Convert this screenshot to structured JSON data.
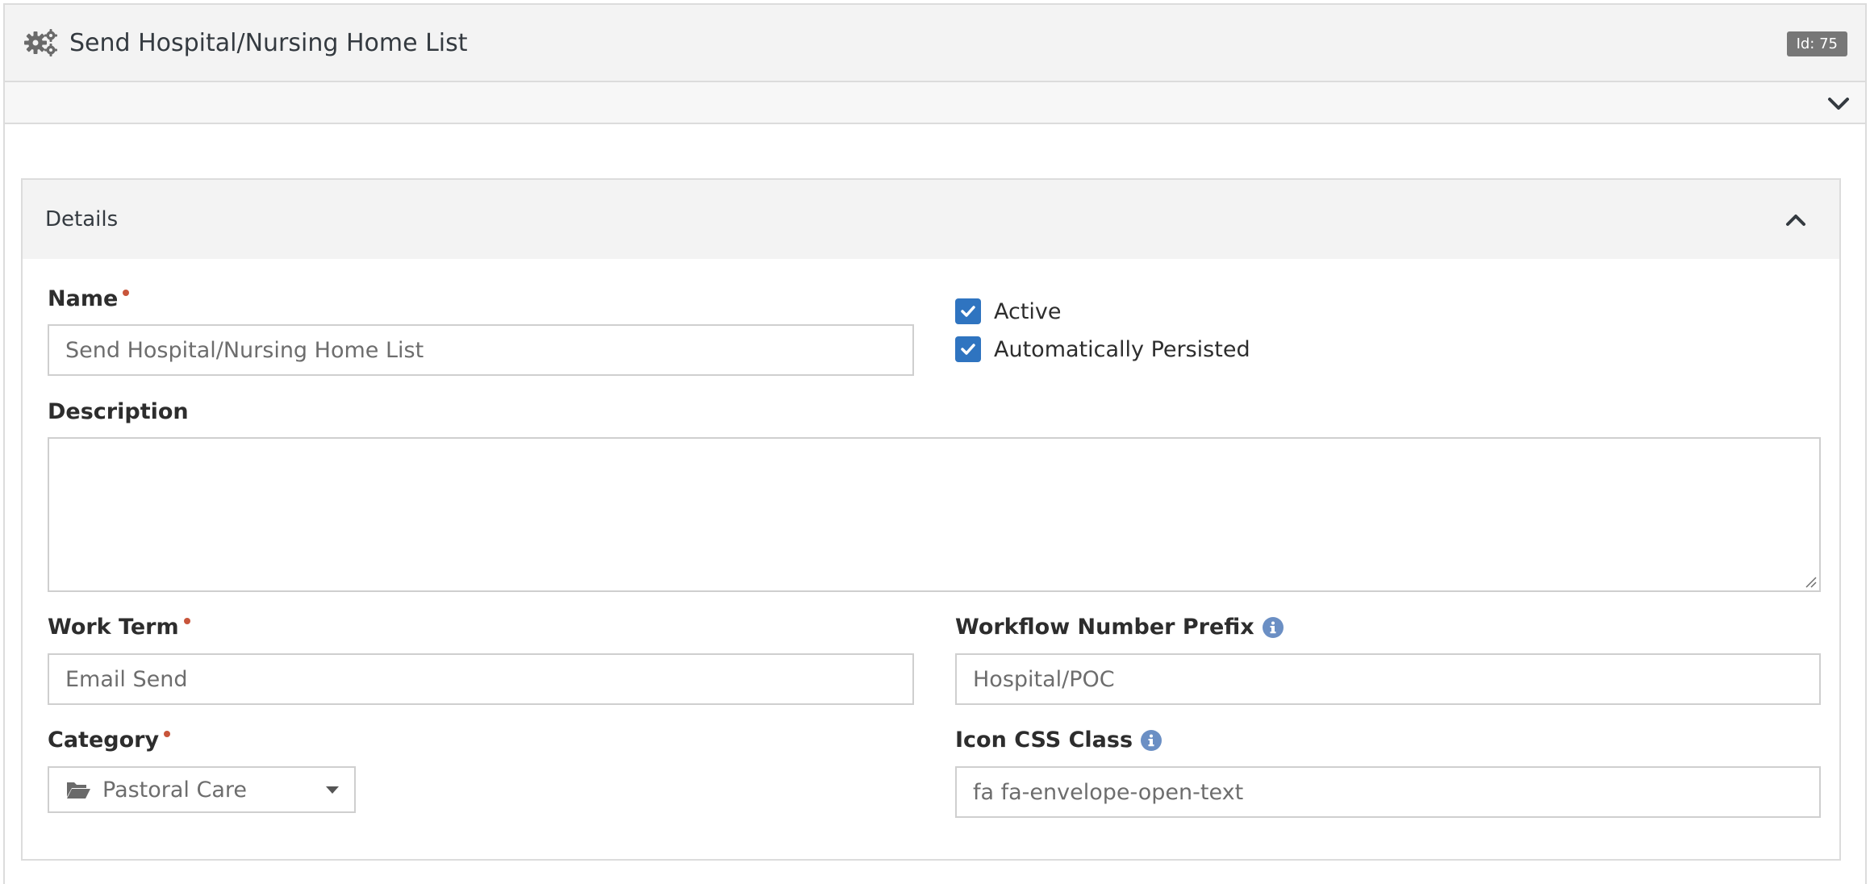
{
  "header": {
    "title": "Send Hospital/Nursing Home List",
    "id_badge": "Id: 75",
    "icon": "gears-icon"
  },
  "subbar": {
    "icon": "chevron-down-icon"
  },
  "details": {
    "title": "Details",
    "icon": "chevron-up-icon",
    "name": {
      "label": "Name",
      "value": "Send Hospital/Nursing Home List"
    },
    "active": {
      "label": "Active",
      "checked": true
    },
    "auto_persisted": {
      "label": "Automatically Persisted",
      "checked": true
    },
    "description": {
      "label": "Description",
      "value": ""
    },
    "work_term": {
      "label": "Work Term",
      "value": "Email Send"
    },
    "workflow_prefix": {
      "label": "Workflow Number Prefix",
      "value": "Hospital/POC"
    },
    "category": {
      "label": "Category",
      "value": "Pastoral Care",
      "icon": "folder-open-icon"
    },
    "icon_css": {
      "label": "Icon CSS Class",
      "value": "fa fa-envelope-open-text"
    }
  },
  "colors": {
    "accent": "#2f74c0",
    "required": "#c8553b",
    "info": "#6b8fc4"
  }
}
